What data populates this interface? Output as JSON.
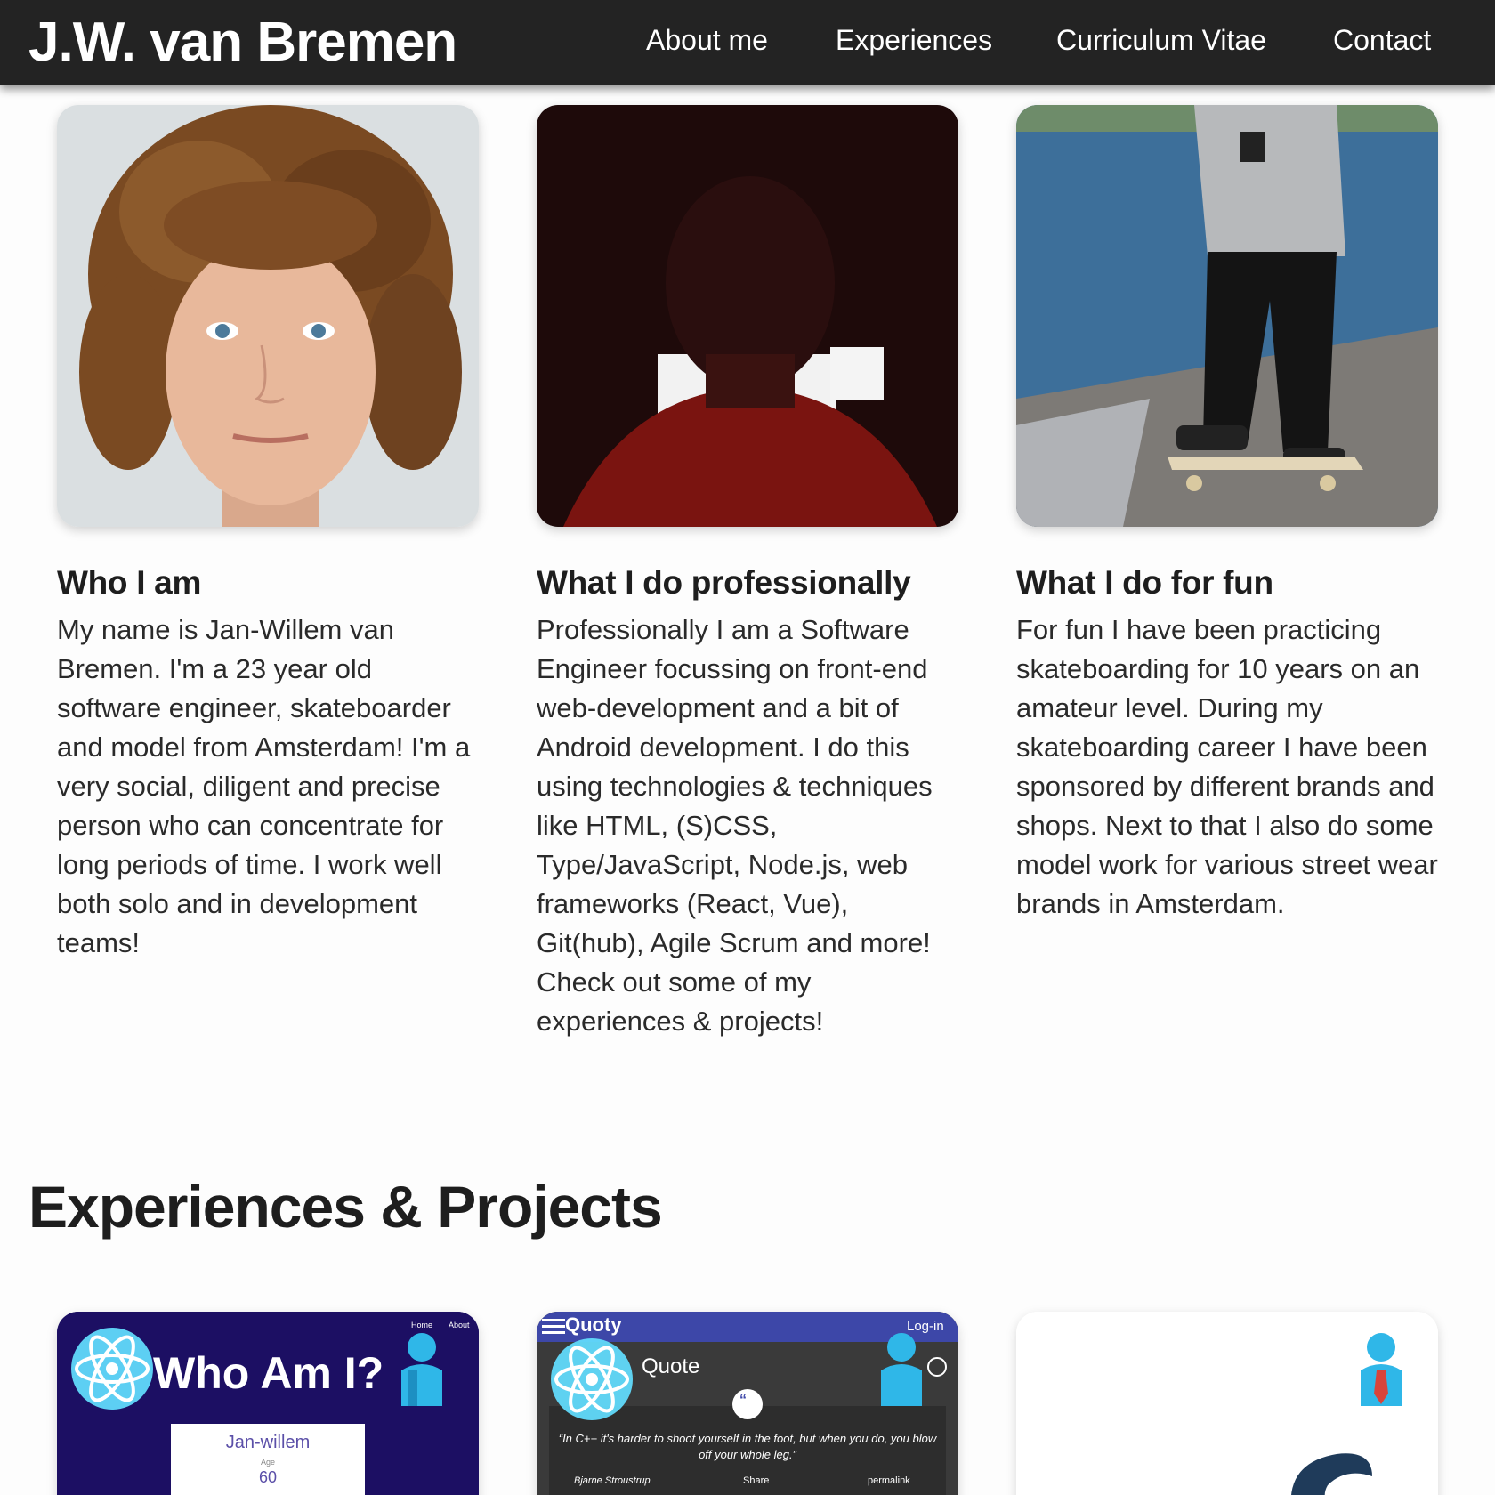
{
  "header": {
    "brand": "J.W. van Bremen",
    "nav": [
      "About me",
      "Experiences",
      "Curriculum Vitae",
      "Contact"
    ]
  },
  "about": [
    {
      "title": "Who I am",
      "text": "My name is Jan-Willem van Bremen. I'm a 23 year old software engineer, skateboarder and model from Amsterdam! I'm a very social, diligent and precise person who can concentrate for long periods of time. I work well both solo and in development teams!"
    },
    {
      "title": "What I do professionally",
      "text": "Professionally I am a Software Engineer focussing on front-end web-development and a bit of Android development. I do this using technologies & techniques like HTML, (S)CSS, Type/JavaScript, Node.js, web frameworks (React, Vue), Git(hub), Agile Scrum and more! Check out some of my experiences & projects!"
    },
    {
      "title": "What I do for fun",
      "text": "For fun I have been practicing skateboarding for 10 years on an amateur level. During my skateboarding career I have been sponsored by different brands and shops. Next to that I also do some model work for various street wear brands in Amsterdam."
    }
  ],
  "experiences": {
    "title": "Experiences & Projects",
    "projects": [
      {
        "heading": "Who Am I?",
        "nav": [
          "Home",
          "About"
        ],
        "name": "Jan-willem",
        "age_label": "Age",
        "age": "60"
      },
      {
        "brand": "Quoty",
        "login": "Log-in",
        "heading": "Quote",
        "quote": "“In C++ it's harder to shoot yourself in the foot, but when you do, you blow off your whole leg.”",
        "author": "Bjarne Stroustrup",
        "share": "Share",
        "permalink": "permalink"
      },
      {}
    ]
  },
  "colors": {
    "header_bg": "#232323",
    "react_blue": "#61dafb",
    "project1_bg": "#1c0f63"
  }
}
